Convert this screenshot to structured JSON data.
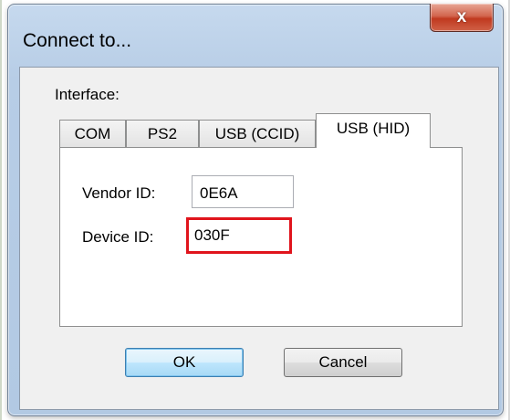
{
  "window": {
    "title": "Connect to...",
    "close_label": "x"
  },
  "interface": {
    "label": "Interface:",
    "tabs": [
      {
        "label": "COM",
        "active": false
      },
      {
        "label": "PS2",
        "active": false
      },
      {
        "label": "USB (CCID)",
        "active": false
      },
      {
        "label": "USB (HID)",
        "active": true
      }
    ]
  },
  "usb_hid": {
    "vendor_id_label": "Vendor ID:",
    "vendor_id_value": "0E6A",
    "device_id_label": "Device ID:",
    "device_id_value": "030F",
    "highlight_color": "#e0141c"
  },
  "buttons": {
    "ok_label": "OK",
    "cancel_label": "Cancel"
  }
}
